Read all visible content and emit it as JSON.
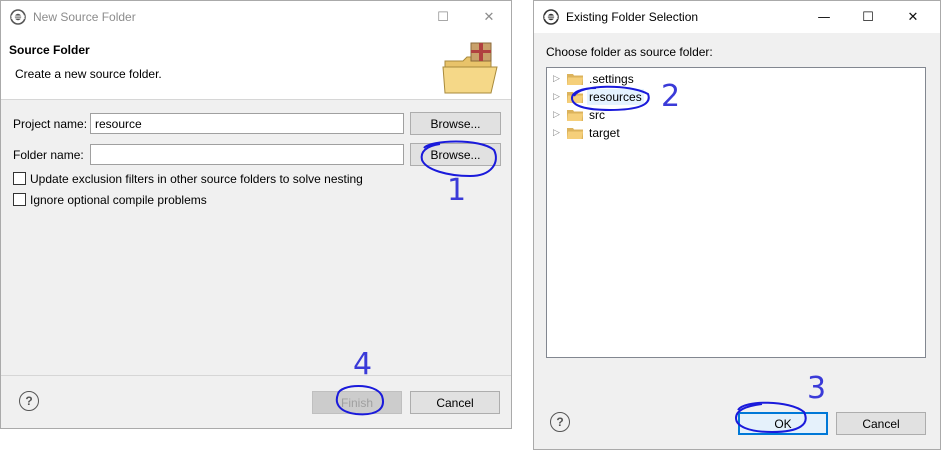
{
  "new_source_folder_dialog": {
    "window_title": "New Source Folder",
    "header_title": "Source Folder",
    "header_description": "Create a new source folder.",
    "project_name_label": "Project name:",
    "project_name_value": "resource",
    "folder_name_label": "Folder name:",
    "folder_name_value": "",
    "browse_label": "Browse...",
    "update_exclusion_label": "Update exclusion filters in other source folders to solve nesting",
    "ignore_optional_label": "Ignore optional compile problems",
    "help_label": "?",
    "finish_label": "Finish",
    "cancel_label": "Cancel"
  },
  "existing_folder_dialog": {
    "window_title": "Existing Folder Selection",
    "prompt": "Choose folder as source folder:",
    "tree_items": [
      {
        "name": ".settings"
      },
      {
        "name": "resources",
        "selected": true
      },
      {
        "name": "src"
      },
      {
        "name": "target"
      }
    ],
    "help_label": "?",
    "ok_label": "OK",
    "cancel_label": "Cancel"
  },
  "window_controls": {
    "minimize": "—",
    "maximize": "☐",
    "close": "✕"
  },
  "annotations": [
    "1",
    "2",
    "3",
    "4"
  ],
  "annotation_color": "#3a3ad8",
  "icons": {
    "title": "eclipse-icon",
    "wizard": "package-folder-icon",
    "tree": "folder-icon"
  }
}
